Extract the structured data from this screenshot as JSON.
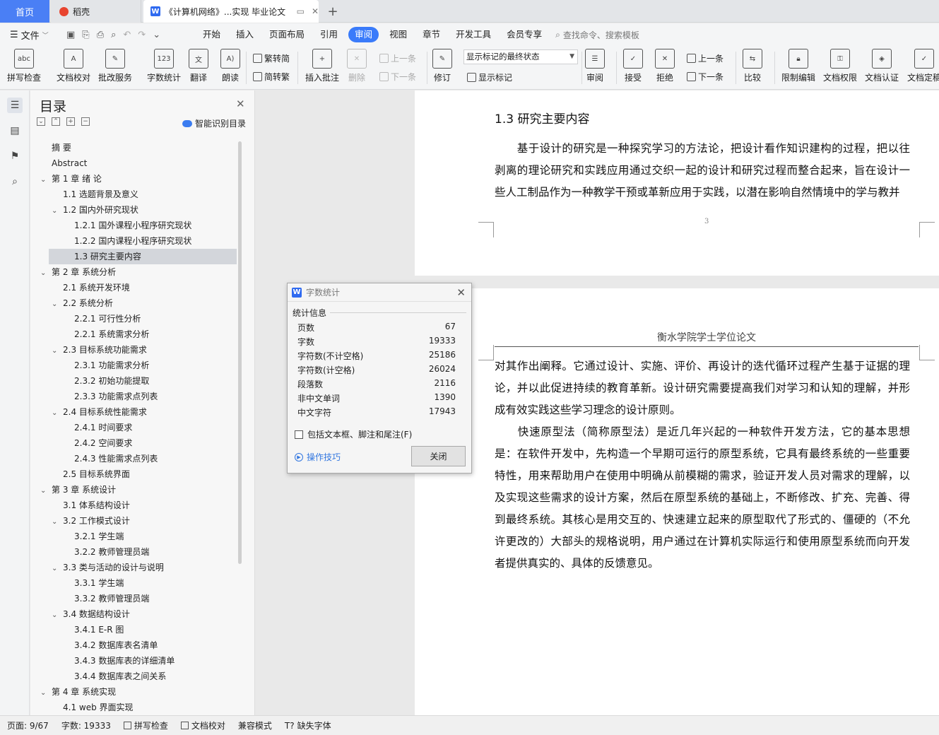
{
  "tabs": {
    "home": "首页",
    "daoke": "稻壳",
    "doc": "《计算机网络》...实现 毕业论文",
    "add": "+"
  },
  "menu": {
    "file": "文件",
    "tabs": [
      "开始",
      "插入",
      "页面布局",
      "引用",
      "审阅",
      "视图",
      "章节",
      "开发工具",
      "会员专享"
    ],
    "active_tab": "审阅",
    "search_placeholder": "查找命令、搜索模板"
  },
  "ribbon": {
    "spell_check": "拼写检查",
    "doc_proof": "文档校对",
    "review_service": "批改服务",
    "word_count": "字数统计",
    "translate": "翻译",
    "read_aloud": "朗读",
    "trad_to_simp": "繁转简",
    "simp_to_trad": "简转繁",
    "insert_comment": "插入批注",
    "delete": "删除",
    "prev_item": "上一条",
    "next_item": "下一条",
    "track_changes": "修订",
    "markup_select": "显示标记的最终状态",
    "show_markup": "显示标记",
    "review": "审阅",
    "accept": "接受",
    "reject": "拒绝",
    "prev_change": "上一条",
    "next_change": "下一条",
    "compare": "比较",
    "restrict_edit": "限制编辑",
    "doc_permission": "文档权限",
    "doc_cert": "文档认证",
    "doc_final": "文档定稿"
  },
  "toc": {
    "title": "目录",
    "smart_label": "智能识别目录",
    "items": [
      {
        "label": "摘    要",
        "level": 1,
        "chev": ""
      },
      {
        "label": "Abstract",
        "level": 1,
        "chev": ""
      },
      {
        "label": "第 1 章  绪  论",
        "level": 1,
        "chev": "⌄"
      },
      {
        "label": "1.1 选题背景及意义",
        "level": 2,
        "chev": ""
      },
      {
        "label": "1.2 国内外研究现状",
        "level": 2,
        "chev": "⌄"
      },
      {
        "label": "1.2.1 国外课程小程序研究现状",
        "level": 3,
        "chev": ""
      },
      {
        "label": "1.2.2 国内课程小程序研究现状",
        "level": 3,
        "chev": ""
      },
      {
        "label": "1.3 研究主要内容",
        "level": 2,
        "chev": "",
        "selected": true
      },
      {
        "label": "第 2 章  系统分析",
        "level": 1,
        "chev": "⌄"
      },
      {
        "label": "2.1 系统开发环境",
        "level": 2,
        "chev": ""
      },
      {
        "label": "2.2 系统分析",
        "level": 2,
        "chev": "⌄"
      },
      {
        "label": "2.2.1 可行性分析",
        "level": 3,
        "chev": ""
      },
      {
        "label": "2.2.1 系统需求分析",
        "level": 3,
        "chev": ""
      },
      {
        "label": "2.3 目标系统功能需求",
        "level": 2,
        "chev": "⌄"
      },
      {
        "label": "2.3.1 功能需求分析",
        "level": 3,
        "chev": ""
      },
      {
        "label": "2.3.2 初始功能提取",
        "level": 3,
        "chev": ""
      },
      {
        "label": "2.3.3  功能需求点列表",
        "level": 3,
        "chev": ""
      },
      {
        "label": "2.4 目标系统性能需求",
        "level": 2,
        "chev": "⌄"
      },
      {
        "label": "2.4.1  时间要求",
        "level": 3,
        "chev": ""
      },
      {
        "label": "2.4.2  空间要求",
        "level": 3,
        "chev": ""
      },
      {
        "label": "2.4.3  性能需求点列表",
        "level": 3,
        "chev": ""
      },
      {
        "label": "2.5 目标系统界面",
        "level": 2,
        "chev": ""
      },
      {
        "label": "第 3 章  系统设计",
        "level": 1,
        "chev": "⌄"
      },
      {
        "label": "3.1  体系结构设计",
        "level": 2,
        "chev": ""
      },
      {
        "label": "3.2  工作模式设计",
        "level": 2,
        "chev": "⌄"
      },
      {
        "label": "3.2.1  学生端",
        "level": 3,
        "chev": ""
      },
      {
        "label": "3.2.2 教师管理员端",
        "level": 3,
        "chev": ""
      },
      {
        "label": "3.3 类与活动的设计与说明",
        "level": 2,
        "chev": "⌄"
      },
      {
        "label": "3.3.1  学生端",
        "level": 3,
        "chev": ""
      },
      {
        "label": "3.3.2 教师管理员端",
        "level": 3,
        "chev": ""
      },
      {
        "label": "3.4 数据结构设计",
        "level": 2,
        "chev": "⌄"
      },
      {
        "label": "3.4.1 E-R 图",
        "level": 3,
        "chev": ""
      },
      {
        "label": "3.4.2  数据库表名清单",
        "level": 3,
        "chev": ""
      },
      {
        "label": "3.4.3  数据库表的详细清单",
        "level": 3,
        "chev": ""
      },
      {
        "label": "3.4.4  数据库表之间关系",
        "level": 3,
        "chev": ""
      },
      {
        "label": "第 4 章  系统实现",
        "level": 1,
        "chev": "⌄"
      },
      {
        "label": "4.1 web 界面实现",
        "level": 2,
        "chev": ""
      }
    ]
  },
  "document": {
    "heading": "1.3 研究主要内容",
    "page1_para": "　　基于设计的研究是一种探究学习的方法论，把设计看作知识建构的过程，把以往剥离的理论研究和实践应用通过交织一起的设计和研究过程而整合起来，旨在设计一些人工制品作为一种教学干预或革新应用于实践，以潜在影响自然情境中的学与教并",
    "page_number": "3",
    "header": "衡水学院学士学位论文",
    "page2_para1": "对其作出阐释。它通过设计、实施、评价、再设计的迭代循环过程产生基于证据的理论，并以此促进持续的教育革新。设计研究需要提高我们对学习和认知的理解，并形成有效实践这些学习理念的设计原则。",
    "page2_para2": "　　快速原型法（简称原型法）是近几年兴起的一种软件开发方法，它的基本思想是：在软件开发中，先构造一个早期可运行的原型系统，它具有最终系统的一些重要特性，用来帮助用户在使用中明确从前模糊的需求，验证开发人员对需求的理解，以及实现这些需求的设计方案，然后在原型系统的基础上，不断修改、扩充、完善、得到最终系统。其核心是用交互的、快速建立起来的原型取代了形式的、僵硬的（不允许更改的）大部头的规格说明，用户通过在计算机实际运行和使用原型系统而向开发者提供真实的、具体的反馈意见。"
  },
  "dialog": {
    "title": "字数统计",
    "section": "统计信息",
    "rows": [
      {
        "label": "页数",
        "value": "67"
      },
      {
        "label": "字数",
        "value": "19333"
      },
      {
        "label": "字符数(不计空格)",
        "value": "25186"
      },
      {
        "label": "字符数(计空格)",
        "value": "26024"
      },
      {
        "label": "段落数",
        "value": "2116"
      },
      {
        "label": "非中文单词",
        "value": "1390"
      },
      {
        "label": "中文字符",
        "value": "17943"
      }
    ],
    "checkbox_label": "包括文本框、脚注和尾注(F)",
    "tips_label": "操作技巧",
    "close_button": "关闭"
  },
  "status": {
    "page": "页面: 9/67",
    "words": "字数: 19333",
    "spell": "拼写检查",
    "proof": "文档校对",
    "compat": "兼容模式",
    "missing_font": "缺失字体"
  },
  "colors": {
    "accent": "#3a7bfa",
    "home_tab": "#4a7ff5",
    "toc_selected": "#d3d6db"
  }
}
